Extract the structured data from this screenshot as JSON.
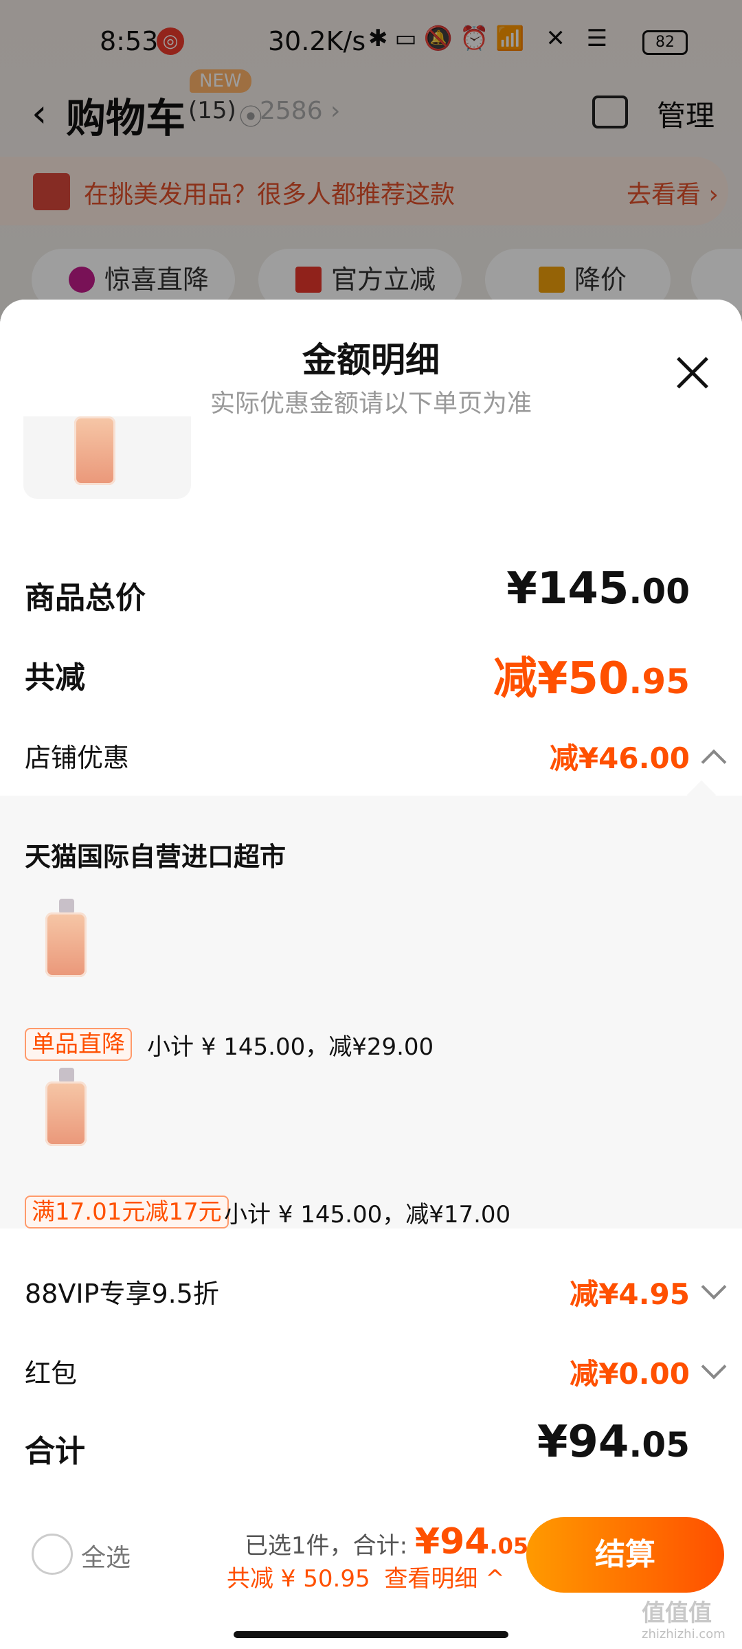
{
  "status_bar": {
    "time": "8:53",
    "speed": "30.2K/s",
    "battery": "82"
  },
  "header": {
    "back_icon": "chevron-left-icon",
    "title": "购物车",
    "count": "(15)",
    "new_badge": "NEW",
    "location_code": "2586 ›",
    "manage_label": "管理"
  },
  "promo_banner": {
    "text": "在挑美发用品？很多人都推荐这款",
    "link": "去看看 ›"
  },
  "filter_chips": [
    "惊喜直降",
    "官方立减",
    "降价"
  ],
  "sheet": {
    "title": "金额明细",
    "subtitle": "实际优惠金额请以下单页为准",
    "total_price_label": "商品总价",
    "total_price_int": "¥145",
    "total_price_dec": ".00",
    "discount_label": "共减",
    "discount_int": "减¥50",
    "discount_dec": ".95",
    "store_discount_label": "店铺优惠",
    "store_discount_value": "减¥46.00",
    "store": {
      "name": "天猫国际自营进口超市",
      "items": [
        {
          "tag": "单品直降",
          "subtotal": "小计 ¥ 145.00，减¥29.00"
        },
        {
          "tag": "满17.01元减17元",
          "subtotal": "小计 ¥ 145.00，减¥17.00"
        }
      ]
    },
    "vip_label": "88VIP专享9.5折",
    "vip_value": "减¥4.95",
    "red_packet_label": "红包",
    "red_packet_value": "减¥0.00",
    "sum_label": "合计",
    "sum_int": "¥94",
    "sum_dec": ".05"
  },
  "checkout": {
    "select_all": "全选",
    "selected_text": "已选1件，合计:",
    "total_int": "¥94",
    "total_dec": ".05",
    "discount_text": "共减 ¥ 50.95",
    "details_link": "查看明细 ^",
    "button": "结算"
  },
  "watermark": {
    "text": "值值值",
    "url": "zhizhizhi.com"
  },
  "colors": {
    "accent": "#ff5000",
    "button_start": "#ff9a00",
    "panel_bg": "#f7f7f7"
  }
}
